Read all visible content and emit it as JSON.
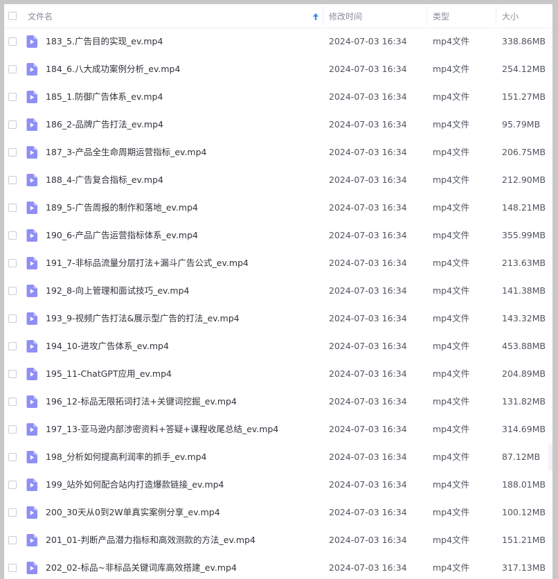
{
  "header": {
    "name_label": "文件名",
    "time_label": "修改时间",
    "type_label": "类型",
    "size_label": "大小",
    "sort_icon": "sort-up-arrow"
  },
  "colors": {
    "accent": "#3d8cf0",
    "icon_purple": "#8f8ef5"
  },
  "rows": [
    {
      "name": "183_5.广告目的实现_ev.mp4",
      "time": "2024-07-03 16:34",
      "type": "mp4文件",
      "size": "338.86MB"
    },
    {
      "name": "184_6.八大成功案例分析_ev.mp4",
      "time": "2024-07-03 16:34",
      "type": "mp4文件",
      "size": "254.12MB"
    },
    {
      "name": "185_1.防御广告体系_ev.mp4",
      "time": "2024-07-03 16:34",
      "type": "mp4文件",
      "size": "151.27MB"
    },
    {
      "name": "186_2-品牌广告打法_ev.mp4",
      "time": "2024-07-03 16:34",
      "type": "mp4文件",
      "size": "95.79MB"
    },
    {
      "name": "187_3-产品全生命周期运营指标_ev.mp4",
      "time": "2024-07-03 16:34",
      "type": "mp4文件",
      "size": "206.75MB"
    },
    {
      "name": "188_4-广告复合指标_ev.mp4",
      "time": "2024-07-03 16:34",
      "type": "mp4文件",
      "size": "212.90MB"
    },
    {
      "name": "189_5-广告周报的制作和落地_ev.mp4",
      "time": "2024-07-03 16:34",
      "type": "mp4文件",
      "size": "148.21MB"
    },
    {
      "name": "190_6-产品广告运营指标体系_ev.mp4",
      "time": "2024-07-03 16:34",
      "type": "mp4文件",
      "size": "355.99MB"
    },
    {
      "name": "191_7-非标品流量分层打法+漏斗广告公式_ev.mp4",
      "time": "2024-07-03 16:34",
      "type": "mp4文件",
      "size": "213.63MB"
    },
    {
      "name": "192_8-向上管理和面试技巧_ev.mp4",
      "time": "2024-07-03 16:34",
      "type": "mp4文件",
      "size": "141.38MB"
    },
    {
      "name": "193_9-视频广告打法&展示型广告的打法_ev.mp4",
      "time": "2024-07-03 16:34",
      "type": "mp4文件",
      "size": "143.32MB"
    },
    {
      "name": "194_10-进攻广告体系_ev.mp4",
      "time": "2024-07-03 16:34",
      "type": "mp4文件",
      "size": "453.88MB"
    },
    {
      "name": "195_11-ChatGPT应用_ev.mp4",
      "time": "2024-07-03 16:34",
      "type": "mp4文件",
      "size": "204.89MB"
    },
    {
      "name": "196_12-标品无限拓词打法+关键词挖掘_ev.mp4",
      "time": "2024-07-03 16:34",
      "type": "mp4文件",
      "size": "131.82MB"
    },
    {
      "name": "197_13-亚马逊内部涉密资料+答疑+课程收尾总结_ev.mp4",
      "time": "2024-07-03 16:34",
      "type": "mp4文件",
      "size": "314.69MB"
    },
    {
      "name": "198_分析如何提高利润率的抓手_ev.mp4",
      "time": "2024-07-03 16:34",
      "type": "mp4文件",
      "size": "87.12MB"
    },
    {
      "name": "199_站外如何配合站内打造爆款链接_ev.mp4",
      "time": "2024-07-03 16:34",
      "type": "mp4文件",
      "size": "188.01MB"
    },
    {
      "name": "200_30天从0到2W单真实案例分享_ev.mp4",
      "time": "2024-07-03 16:34",
      "type": "mp4文件",
      "size": "100.12MB"
    },
    {
      "name": "201_01-判断产品潜力指标和高效测款的方法_ev.mp4",
      "time": "2024-07-03 16:34",
      "type": "mp4文件",
      "size": "151.21MB"
    },
    {
      "name": "202_02-标品~非标品关键词库高效搭建_ev.mp4",
      "time": "2024-07-03 16:34",
      "type": "mp4文件",
      "size": "317.13MB"
    }
  ]
}
